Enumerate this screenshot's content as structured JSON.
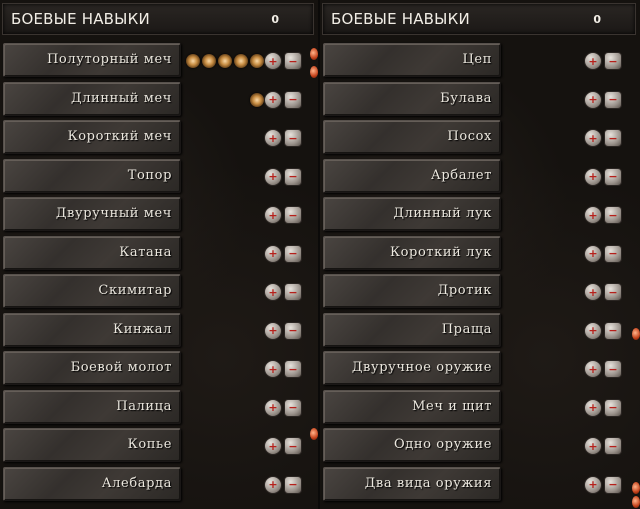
{
  "left_panel": {
    "title": "БОЕВЫЕ НАВЫКИ",
    "points": "0",
    "skills": [
      {
        "label": "Полуторный меч",
        "pips": 5
      },
      {
        "label": "Длинный меч",
        "pips": 1
      },
      {
        "label": "Короткий меч",
        "pips": 0
      },
      {
        "label": "Топор",
        "pips": 0
      },
      {
        "label": "Двуручный меч",
        "pips": 0
      },
      {
        "label": "Катана",
        "pips": 0
      },
      {
        "label": "Скимитар",
        "pips": 0
      },
      {
        "label": "Кинжал",
        "pips": 0
      },
      {
        "label": "Боевой молот",
        "pips": 0
      },
      {
        "label": "Палица",
        "pips": 0
      },
      {
        "label": "Копье",
        "pips": 0
      },
      {
        "label": "Алебарда",
        "pips": 0
      }
    ]
  },
  "right_panel": {
    "title": "БОЕВЫЕ НАВЫКИ",
    "points": "0",
    "skills": [
      {
        "label": "Цеп",
        "pips": 0
      },
      {
        "label": "Булава",
        "pips": 0
      },
      {
        "label": "Посох",
        "pips": 0
      },
      {
        "label": "Арбалет",
        "pips": 0
      },
      {
        "label": "Длинный лук",
        "pips": 0
      },
      {
        "label": "Короткий лук",
        "pips": 0
      },
      {
        "label": "Дротик",
        "pips": 0
      },
      {
        "label": "Праща",
        "pips": 0
      },
      {
        "label": "Двуручное оружие",
        "pips": 0
      },
      {
        "label": "Меч и щит",
        "pips": 0
      },
      {
        "label": "Одно оружие",
        "pips": 0
      },
      {
        "label": "Два вида оружия",
        "pips": 0
      }
    ]
  },
  "buttons": {
    "increase_glyph": "+",
    "decrease_glyph": "−"
  }
}
